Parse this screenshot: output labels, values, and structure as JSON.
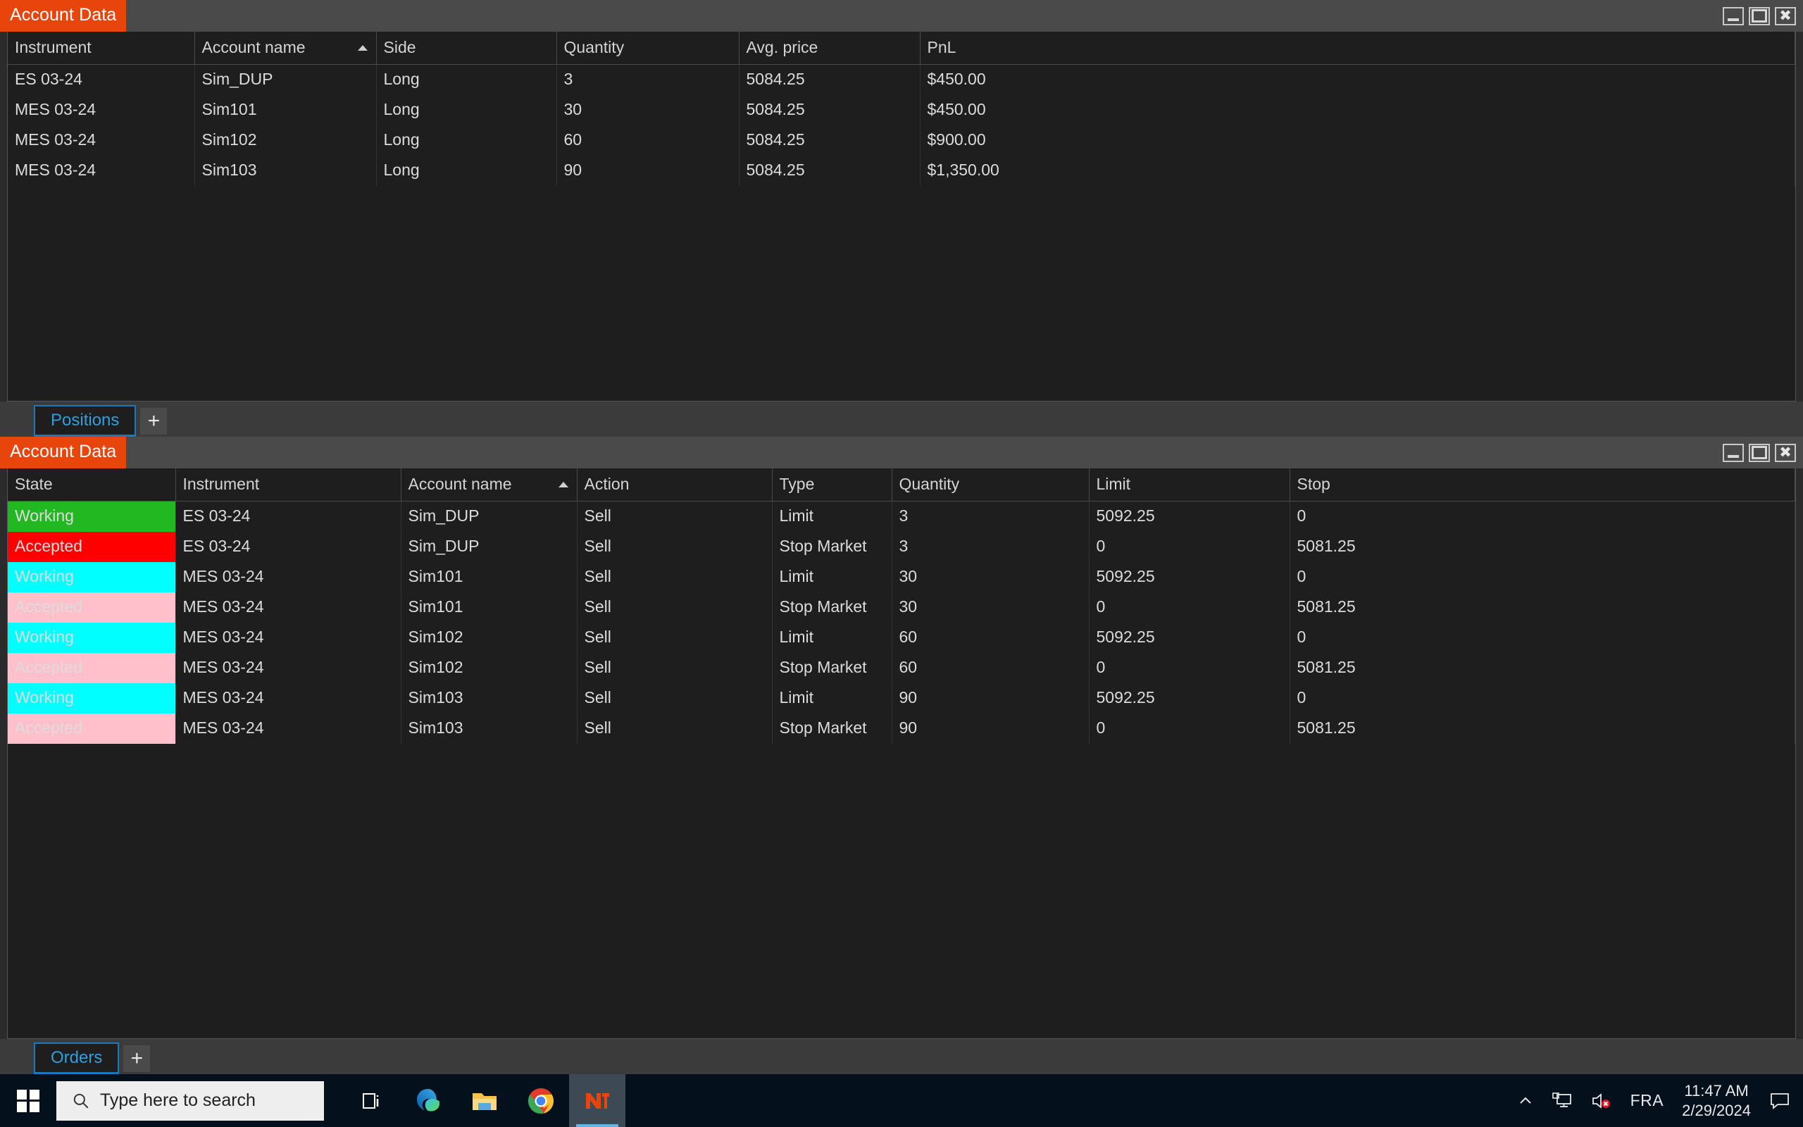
{
  "positions_window": {
    "title": "Account Data",
    "controls": {
      "minimize": "–",
      "maximize": "□",
      "close": "✖"
    },
    "columns": [
      "Instrument",
      "Account name",
      "Side",
      "Quantity",
      "Avg. price",
      "PnL"
    ],
    "sorted_column": "Account name",
    "sort_direction": "ascending",
    "rows": [
      {
        "instrument": "ES 03-24",
        "account": "Sim_DUP",
        "side": "Long",
        "quantity": "3",
        "avg_price": "5084.25",
        "pnl": "$450.00"
      },
      {
        "instrument": "MES 03-24",
        "account": "Sim101",
        "side": "Long",
        "quantity": "30",
        "avg_price": "5084.25",
        "pnl": "$450.00"
      },
      {
        "instrument": "MES 03-24",
        "account": "Sim102",
        "side": "Long",
        "quantity": "60",
        "avg_price": "5084.25",
        "pnl": "$900.00"
      },
      {
        "instrument": "MES 03-24",
        "account": "Sim103",
        "side": "Long",
        "quantity": "90",
        "avg_price": "5084.25",
        "pnl": "$1,350.00"
      }
    ],
    "tab_label": "Positions",
    "add_tab_label": "+"
  },
  "orders_window": {
    "title": "Account Data",
    "controls": {
      "minimize": "–",
      "maximize": "□",
      "close": "✖"
    },
    "columns": [
      "State",
      "Instrument",
      "Account name",
      "Action",
      "Type",
      "Quantity",
      "Limit",
      "Stop"
    ],
    "sorted_column": "Account name",
    "sort_direction": "ascending",
    "rows": [
      {
        "state": "Working",
        "state_color": "#22b822",
        "instrument": "ES 03-24",
        "account": "Sim_DUP",
        "action": "Sell",
        "type": "Limit",
        "quantity": "3",
        "limit": "5092.25",
        "stop": "0"
      },
      {
        "state": "Accepted",
        "state_color": "#fe0000",
        "instrument": "ES 03-24",
        "account": "Sim_DUP",
        "action": "Sell",
        "type": "Stop Market",
        "quantity": "3",
        "limit": "0",
        "stop": "5081.25"
      },
      {
        "state": "Working",
        "state_color": "#00ffff",
        "instrument": "MES 03-24",
        "account": "Sim101",
        "action": "Sell",
        "type": "Limit",
        "quantity": "30",
        "limit": "5092.25",
        "stop": "0"
      },
      {
        "state": "Accepted",
        "state_color": "#ffc0cb",
        "instrument": "MES 03-24",
        "account": "Sim101",
        "action": "Sell",
        "type": "Stop Market",
        "quantity": "30",
        "limit": "0",
        "stop": "5081.25"
      },
      {
        "state": "Working",
        "state_color": "#00ffff",
        "instrument": "MES 03-24",
        "account": "Sim102",
        "action": "Sell",
        "type": "Limit",
        "quantity": "60",
        "limit": "5092.25",
        "stop": "0"
      },
      {
        "state": "Accepted",
        "state_color": "#ffc0cb",
        "instrument": "MES 03-24",
        "account": "Sim102",
        "action": "Sell",
        "type": "Stop Market",
        "quantity": "60",
        "limit": "0",
        "stop": "5081.25"
      },
      {
        "state": "Working",
        "state_color": "#00ffff",
        "instrument": "MES 03-24",
        "account": "Sim103",
        "action": "Sell",
        "type": "Limit",
        "quantity": "90",
        "limit": "5092.25",
        "stop": "0"
      },
      {
        "state": "Accepted",
        "state_color": "#ffc0cb",
        "instrument": "MES 03-24",
        "account": "Sim103",
        "action": "Sell",
        "type": "Stop Market",
        "quantity": "90",
        "limit": "0",
        "stop": "5081.25"
      }
    ],
    "tab_label": "Orders",
    "add_tab_label": "+"
  },
  "taskbar": {
    "start_icon": "windows-logo-icon",
    "search_placeholder": "Type here to search",
    "search_icon": "search-icon",
    "items": [
      {
        "name": "task-view-icon",
        "label": "Task View"
      },
      {
        "name": "edge-icon",
        "label": "Microsoft Edge"
      },
      {
        "name": "file-explorer-icon",
        "label": "File Explorer"
      },
      {
        "name": "chrome-icon",
        "label": "Google Chrome"
      },
      {
        "name": "ninjatrader-icon",
        "label": "NinjaTrader"
      }
    ],
    "tray": {
      "show_hidden_icons": "show-hidden-icons-chevron",
      "network_icon": "network-icon",
      "volume_icon": "volume-muted-icon",
      "language": "FRA",
      "time": "11:47 AM",
      "date": "2/29/2024",
      "action_center_icon": "action-center-icon"
    }
  },
  "theme": {
    "accent_orange": "#e8450c",
    "tab_blue": "#2f9fe0",
    "profit_green": "#22b822",
    "panel_bg": "#1e1e1e",
    "chrome_bg": "#3b3b3b"
  }
}
